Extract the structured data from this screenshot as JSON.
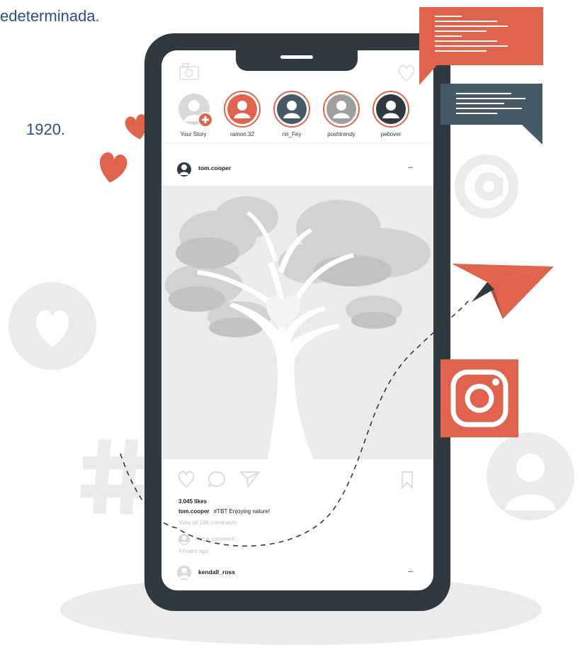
{
  "background": {
    "line1": "edeterminada.",
    "line2": "1920."
  },
  "app": {
    "stories": [
      {
        "label": "Your Story",
        "color": "#cfcfcf",
        "ring": false
      },
      {
        "label": "ramon.32",
        "color": "#e0644d",
        "ring": true
      },
      {
        "label": "riri_Fey",
        "color": "#455a64",
        "ring": true
      },
      {
        "label": "poshtrendy",
        "color": "#9e9e9e",
        "ring": true
      },
      {
        "label": "petlover",
        "color": "#2e3a3f",
        "ring": true
      }
    ],
    "post": {
      "username": "tom.cooper",
      "more": "...",
      "likes": "3.045 likes",
      "caption_user": "tom.cooper",
      "caption_text": "#TBT Enjoying nature!",
      "view_comments": "View all 246 comments",
      "add_comment_placeholder": "Add a comment...",
      "time": "4 hours ago"
    },
    "next_post": {
      "username": "kendall_ross",
      "more": "..."
    }
  },
  "colors": {
    "accent": "#e0644d",
    "dark": "#2e3a3f",
    "slate": "#455a64",
    "light_gray": "#ebebeb"
  },
  "icons": [
    "camera-icon",
    "heart-icon",
    "comment-icon",
    "share-icon",
    "bookmark-icon",
    "at-icon",
    "hashtag-icon",
    "instagram-icon",
    "paper-plane-icon",
    "chat-bubble-icon",
    "user-icon"
  ]
}
